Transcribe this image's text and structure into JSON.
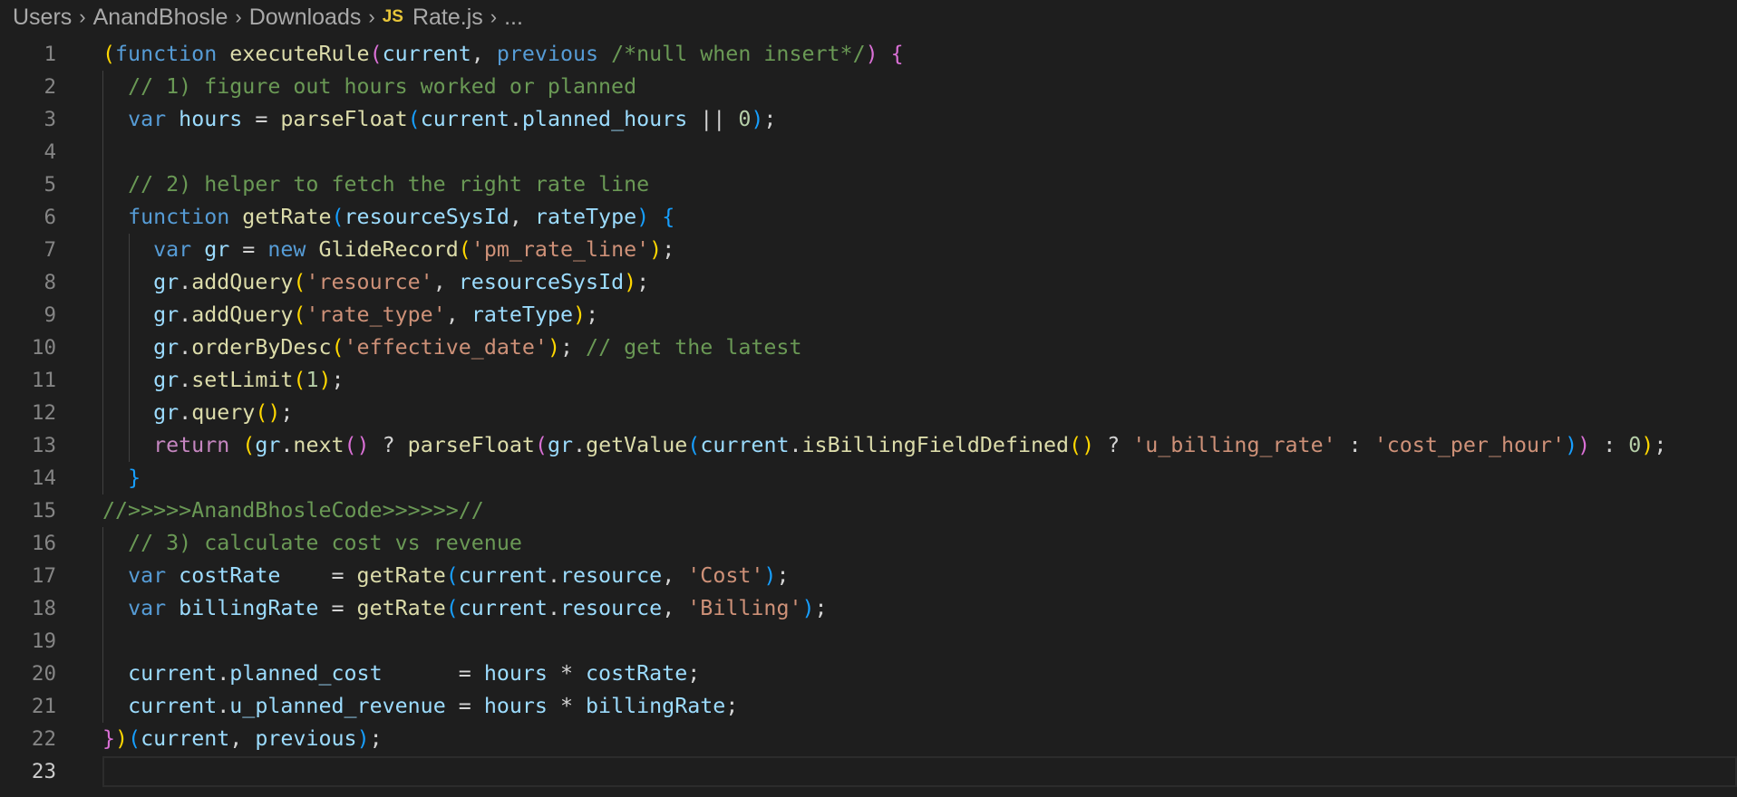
{
  "breadcrumb": {
    "items": [
      "Users",
      "AnandBhosle",
      "Downloads",
      "Rate.js",
      "..."
    ],
    "file_icon": "JS"
  },
  "editor": {
    "language": "javascript",
    "active_line": 23,
    "lines": [
      {
        "n": "1",
        "tokens": [
          [
            "p1",
            "("
          ],
          [
            "kw",
            "function "
          ],
          [
            "fn",
            "executeRule"
          ],
          [
            "p2",
            "("
          ],
          [
            "var",
            "current"
          ],
          [
            "op",
            ", "
          ],
          [
            "kw",
            "previous "
          ],
          [
            "cmt",
            "/*null when insert*/"
          ],
          [
            "p2",
            ")"
          ],
          [
            "op",
            " "
          ],
          [
            "p2",
            "{"
          ]
        ]
      },
      {
        "n": "2",
        "tokens": [
          [
            "op",
            "  "
          ],
          [
            "cmt",
            "// 1) figure out hours worked or planned"
          ]
        ]
      },
      {
        "n": "3",
        "tokens": [
          [
            "op",
            "  "
          ],
          [
            "kw",
            "var "
          ],
          [
            "var",
            "hours"
          ],
          [
            "op",
            " = "
          ],
          [
            "fn",
            "parseFloat"
          ],
          [
            "p3",
            "("
          ],
          [
            "var",
            "current"
          ],
          [
            "op",
            "."
          ],
          [
            "var",
            "planned_hours"
          ],
          [
            "op",
            " || "
          ],
          [
            "num",
            "0"
          ],
          [
            "p3",
            ")"
          ],
          [
            "op",
            ";"
          ]
        ]
      },
      {
        "n": "4",
        "tokens": []
      },
      {
        "n": "5",
        "tokens": [
          [
            "op",
            "  "
          ],
          [
            "cmt",
            "// 2) helper to fetch the right rate line"
          ]
        ]
      },
      {
        "n": "6",
        "tokens": [
          [
            "op",
            "  "
          ],
          [
            "kw",
            "function "
          ],
          [
            "fn",
            "getRate"
          ],
          [
            "p3",
            "("
          ],
          [
            "var",
            "resourceSysId"
          ],
          [
            "op",
            ", "
          ],
          [
            "var",
            "rateType"
          ],
          [
            "p3",
            ")"
          ],
          [
            "op",
            " "
          ],
          [
            "p3",
            "{"
          ]
        ]
      },
      {
        "n": "7",
        "tokens": [
          [
            "op",
            "    "
          ],
          [
            "kw",
            "var "
          ],
          [
            "var",
            "gr"
          ],
          [
            "op",
            " = "
          ],
          [
            "kw",
            "new "
          ],
          [
            "cls",
            "GlideRecord"
          ],
          [
            "p1",
            "("
          ],
          [
            "str",
            "'pm_rate_line'"
          ],
          [
            "p1",
            ")"
          ],
          [
            "op",
            ";"
          ]
        ]
      },
      {
        "n": "8",
        "tokens": [
          [
            "op",
            "    "
          ],
          [
            "var",
            "gr"
          ],
          [
            "op",
            "."
          ],
          [
            "fn",
            "addQuery"
          ],
          [
            "p1",
            "("
          ],
          [
            "str",
            "'resource'"
          ],
          [
            "op",
            ", "
          ],
          [
            "var",
            "resourceSysId"
          ],
          [
            "p1",
            ")"
          ],
          [
            "op",
            ";"
          ]
        ]
      },
      {
        "n": "9",
        "tokens": [
          [
            "op",
            "    "
          ],
          [
            "var",
            "gr"
          ],
          [
            "op",
            "."
          ],
          [
            "fn",
            "addQuery"
          ],
          [
            "p1",
            "("
          ],
          [
            "str",
            "'rate_type'"
          ],
          [
            "op",
            ", "
          ],
          [
            "var",
            "rateType"
          ],
          [
            "p1",
            ")"
          ],
          [
            "op",
            ";"
          ]
        ]
      },
      {
        "n": "10",
        "tokens": [
          [
            "op",
            "    "
          ],
          [
            "var",
            "gr"
          ],
          [
            "op",
            "."
          ],
          [
            "fn",
            "orderByDesc"
          ],
          [
            "p1",
            "("
          ],
          [
            "str",
            "'effective_date'"
          ],
          [
            "p1",
            ")"
          ],
          [
            "op",
            "; "
          ],
          [
            "cmt",
            "// get the latest"
          ]
        ]
      },
      {
        "n": "11",
        "tokens": [
          [
            "op",
            "    "
          ],
          [
            "var",
            "gr"
          ],
          [
            "op",
            "."
          ],
          [
            "fn",
            "setLimit"
          ],
          [
            "p1",
            "("
          ],
          [
            "num",
            "1"
          ],
          [
            "p1",
            ")"
          ],
          [
            "op",
            ";"
          ]
        ]
      },
      {
        "n": "12",
        "tokens": [
          [
            "op",
            "    "
          ],
          [
            "var",
            "gr"
          ],
          [
            "op",
            "."
          ],
          [
            "fn",
            "query"
          ],
          [
            "p1",
            "()"
          ],
          [
            "op",
            ";"
          ]
        ]
      },
      {
        "n": "13",
        "tokens": [
          [
            "op",
            "    "
          ],
          [
            "ctl",
            "return "
          ],
          [
            "p1",
            "("
          ],
          [
            "var",
            "gr"
          ],
          [
            "op",
            "."
          ],
          [
            "fn",
            "next"
          ],
          [
            "p2",
            "()"
          ],
          [
            "op",
            " ? "
          ],
          [
            "fn",
            "parseFloat"
          ],
          [
            "p2",
            "("
          ],
          [
            "var",
            "gr"
          ],
          [
            "op",
            "."
          ],
          [
            "fn",
            "getValue"
          ],
          [
            "p3",
            "("
          ],
          [
            "var",
            "current"
          ],
          [
            "op",
            "."
          ],
          [
            "fn",
            "isBillingFieldDefined"
          ],
          [
            "p1",
            "()"
          ],
          [
            "op",
            " ? "
          ],
          [
            "str",
            "'u_billing_rate'"
          ],
          [
            "op",
            " : "
          ],
          [
            "str",
            "'cost_per_hour'"
          ],
          [
            "p3",
            ")"
          ],
          [
            "p2",
            ")"
          ],
          [
            "op",
            " : "
          ],
          [
            "num",
            "0"
          ],
          [
            "p1",
            ")"
          ],
          [
            "op",
            ";"
          ]
        ]
      },
      {
        "n": "14",
        "tokens": [
          [
            "op",
            "  "
          ],
          [
            "p3",
            "}"
          ]
        ]
      },
      {
        "n": "15",
        "tokens": [
          [
            "cmt",
            "//>>>>>AnandBhosleCode>>>>>>//"
          ]
        ]
      },
      {
        "n": "16",
        "tokens": [
          [
            "op",
            "  "
          ],
          [
            "cmt",
            "// 3) calculate cost vs revenue"
          ]
        ]
      },
      {
        "n": "17",
        "tokens": [
          [
            "op",
            "  "
          ],
          [
            "kw",
            "var "
          ],
          [
            "var",
            "costRate"
          ],
          [
            "op",
            "    = "
          ],
          [
            "fn",
            "getRate"
          ],
          [
            "p3",
            "("
          ],
          [
            "var",
            "current"
          ],
          [
            "op",
            "."
          ],
          [
            "var",
            "resource"
          ],
          [
            "op",
            ", "
          ],
          [
            "str",
            "'Cost'"
          ],
          [
            "p3",
            ")"
          ],
          [
            "op",
            ";"
          ]
        ]
      },
      {
        "n": "18",
        "tokens": [
          [
            "op",
            "  "
          ],
          [
            "kw",
            "var "
          ],
          [
            "var",
            "billingRate"
          ],
          [
            "op",
            " = "
          ],
          [
            "fn",
            "getRate"
          ],
          [
            "p3",
            "("
          ],
          [
            "var",
            "current"
          ],
          [
            "op",
            "."
          ],
          [
            "var",
            "resource"
          ],
          [
            "op",
            ", "
          ],
          [
            "str",
            "'Billing'"
          ],
          [
            "p3",
            ")"
          ],
          [
            "op",
            ";"
          ]
        ]
      },
      {
        "n": "19",
        "tokens": []
      },
      {
        "n": "20",
        "tokens": [
          [
            "op",
            "  "
          ],
          [
            "var",
            "current"
          ],
          [
            "op",
            "."
          ],
          [
            "var",
            "planned_cost"
          ],
          [
            "op",
            "      = "
          ],
          [
            "var",
            "hours"
          ],
          [
            "op",
            " * "
          ],
          [
            "var",
            "costRate"
          ],
          [
            "op",
            ";"
          ]
        ]
      },
      {
        "n": "21",
        "tokens": [
          [
            "op",
            "  "
          ],
          [
            "var",
            "current"
          ],
          [
            "op",
            "."
          ],
          [
            "var",
            "u_planned_revenue"
          ],
          [
            "op",
            " = "
          ],
          [
            "var",
            "hours"
          ],
          [
            "op",
            " * "
          ],
          [
            "var",
            "billingRate"
          ],
          [
            "op",
            ";"
          ]
        ]
      },
      {
        "n": "22",
        "tokens": [
          [
            "p2",
            "}"
          ],
          [
            "p1",
            ")"
          ],
          [
            "p3",
            "("
          ],
          [
            "var",
            "current"
          ],
          [
            "op",
            ", "
          ],
          [
            "var",
            "previous"
          ],
          [
            "p3",
            ")"
          ],
          [
            "op",
            ";"
          ]
        ]
      },
      {
        "n": "23",
        "tokens": []
      }
    ]
  },
  "colors": {
    "background": "#1e1e1e",
    "keyword": "#569cd6",
    "control": "#c586c0",
    "function": "#dcdcaa",
    "variable": "#9cdcfe",
    "string": "#ce9178",
    "number": "#b5cea8",
    "comment": "#6a9955",
    "bracket_1": "#ffd700",
    "bracket_2": "#da70d6",
    "bracket_3": "#179fff"
  }
}
